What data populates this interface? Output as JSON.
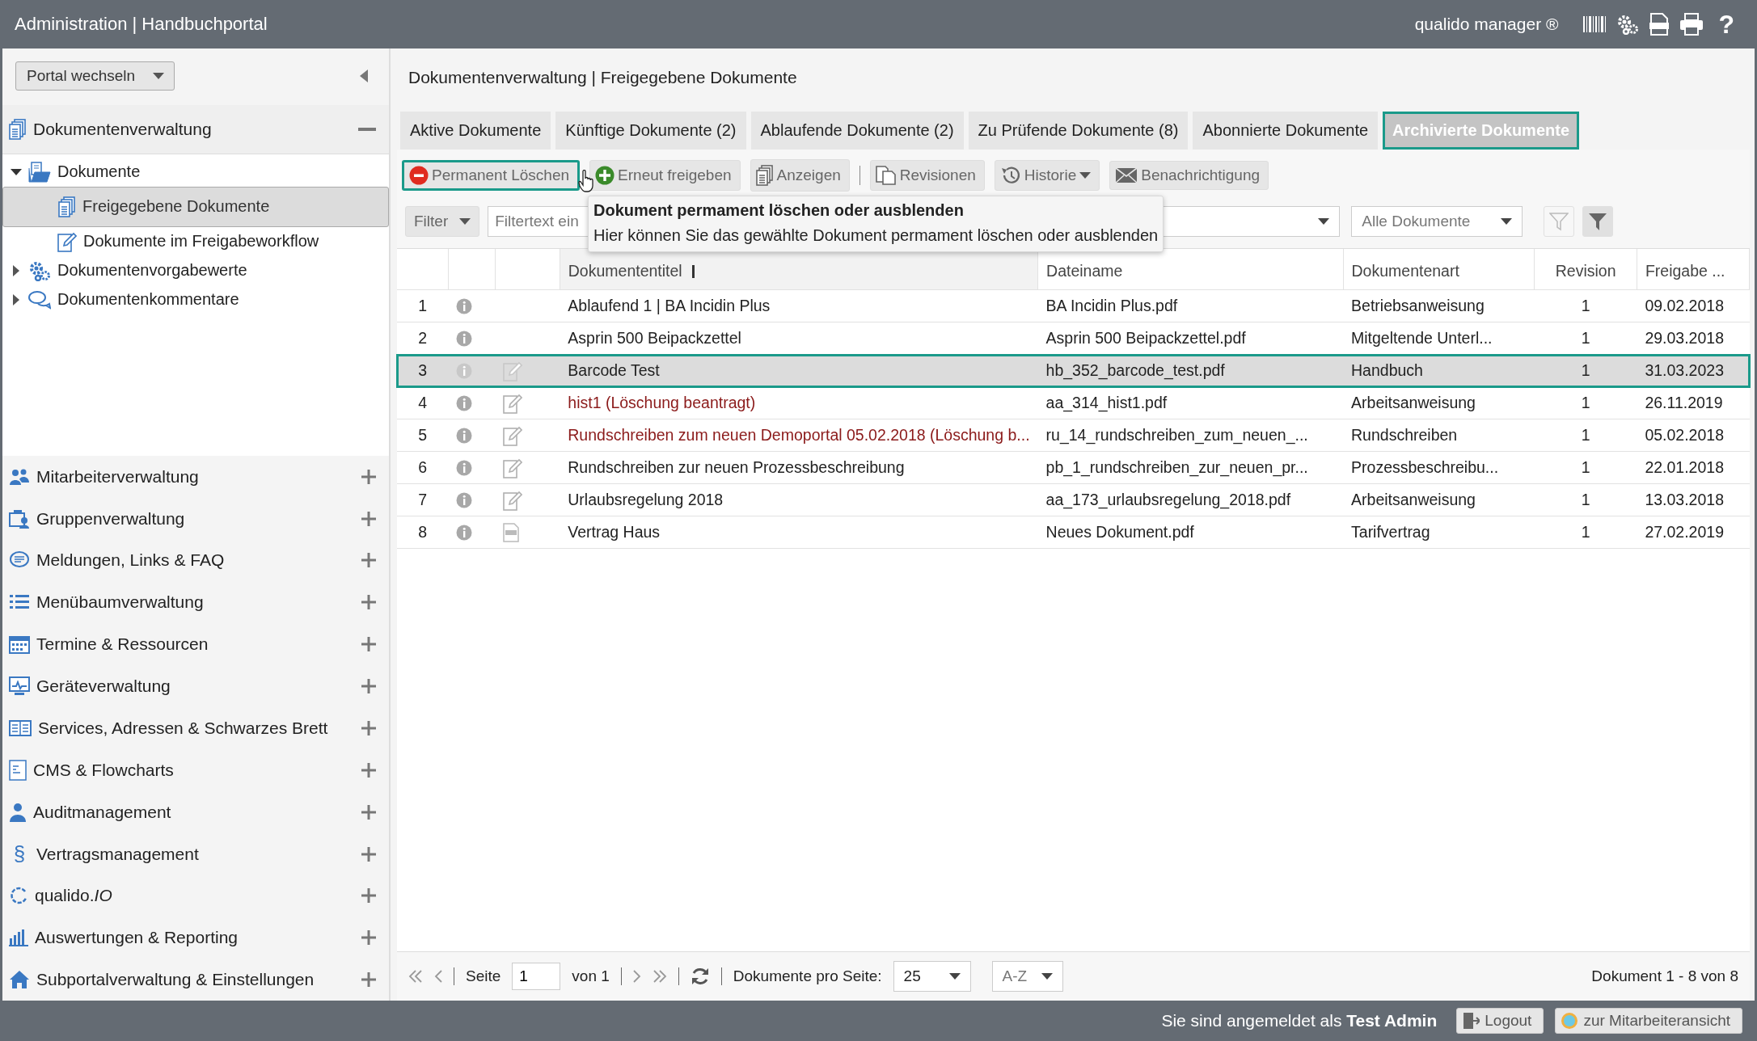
{
  "header": {
    "title": "Administration | Handbuchportal",
    "product": "qualido manager ®",
    "help": "?"
  },
  "sidebar": {
    "portal_switch": "Portal wechseln",
    "sections": [
      {
        "label": "Dokumentenverwaltung",
        "expanded": true,
        "tree": [
          {
            "label": "Dokumente",
            "expanded": true,
            "selected": false,
            "children": [
              {
                "label": "Freigegebene Dokumente",
                "selected": true
              },
              {
                "label": "Dokumente im Freigabeworkflow",
                "selected": false
              }
            ]
          },
          {
            "label": "Dokumentenvorgabewerte",
            "expanded": false,
            "selected": false
          },
          {
            "label": "Dokumentenkommentare",
            "expanded": false,
            "selected": false
          }
        ]
      },
      {
        "label": "Mitarbeiterverwaltung",
        "expanded": false
      },
      {
        "label": "Gruppenverwaltung",
        "expanded": false
      },
      {
        "label": "Meldungen, Links & FAQ",
        "expanded": false
      },
      {
        "label": "Menübaumverwaltung",
        "expanded": false
      },
      {
        "label": "Termine & Ressourcen",
        "expanded": false
      },
      {
        "label": "Geräteverwaltung",
        "expanded": false
      },
      {
        "label": "Services, Adressen & Schwarzes Brett",
        "expanded": false
      },
      {
        "label": "CMS & Flowcharts",
        "expanded": false
      },
      {
        "label": "Auditmanagement",
        "expanded": false
      },
      {
        "label": "Vertragsmanagement",
        "expanded": false,
        "symbol": "§"
      },
      {
        "label": "qualido.*IO*",
        "expanded": false
      },
      {
        "label": "Auswertungen & Reporting",
        "expanded": false
      },
      {
        "label": "Subportalverwaltung & Einstellungen",
        "expanded": false
      }
    ]
  },
  "main": {
    "breadcrumb": "Dokumentenverwaltung | Freigegebene Dokumente",
    "tabs": [
      {
        "label": "Aktive Dokumente",
        "selected": false
      },
      {
        "label": "Künftige Dokumente (2)",
        "selected": false
      },
      {
        "label": "Ablaufende Dokumente (2)",
        "selected": false
      },
      {
        "label": "Zu Prüfende Dokumente (8)",
        "selected": false
      },
      {
        "label": "Abonnierte Dokumente",
        "selected": false
      },
      {
        "label": "Archivierte Dokumente",
        "selected": true
      }
    ],
    "toolbar": [
      {
        "kind": "delete",
        "label": "Permanent Löschen",
        "focused": true
      },
      {
        "kind": "release",
        "label": "Erneut freigeben",
        "focused": false
      },
      {
        "kind": "view",
        "label": "Anzeigen",
        "focused": false
      },
      {
        "kind": "separator"
      },
      {
        "kind": "revisions",
        "label": "Revisionen",
        "focused": false
      },
      {
        "kind": "history",
        "label": "Historie",
        "focused": false
      },
      {
        "kind": "notify",
        "label": "Benachrichtigung",
        "focused": false
      }
    ],
    "filter": {
      "label": "Filter",
      "placeholder": "Filtertext ein",
      "scope": "Alle Dokumente"
    },
    "tooltip": {
      "title": "Dokument permament löschen oder ausblenden",
      "text": "Hier können Sie das gewählte Dokument permament löschen oder ausblenden"
    },
    "table": {
      "columns": [
        "Dokumententitel",
        "Dateiname",
        "Dokumentenart",
        "Revision",
        "Freigabe ..."
      ],
      "rows": [
        {
          "number": "1",
          "kind": "plain",
          "title": "Ablaufend 1 | BA Incidin Plus",
          "file": "BA Incidin Plus.pdf",
          "type": "Betriebsanweisung",
          "revision": "1",
          "date": "09.02.2018",
          "deletion_pending": false,
          "selected": false
        },
        {
          "number": "2",
          "kind": "plain",
          "title": "Asprin 500 Beipackzettel",
          "file": "Asprin 500 Beipackzettel.pdf",
          "type": "Mitgeltende Unterl...",
          "revision": "1",
          "date": "29.03.2018",
          "deletion_pending": false,
          "selected": false
        },
        {
          "number": "3",
          "kind": "editable",
          "title": "Barcode Test",
          "file": "hb_352_barcode_test.pdf",
          "type": "Handbuch",
          "revision": "1",
          "date": "31.03.2023",
          "deletion_pending": false,
          "selected": true
        },
        {
          "number": "4",
          "kind": "editable",
          "title": "hist1 (Löschung beantragt)",
          "file": "aa_314_hist1.pdf",
          "type": "Arbeitsanweisung",
          "revision": "1",
          "date": "26.11.2019",
          "deletion_pending": true,
          "selected": false
        },
        {
          "number": "5",
          "kind": "editable",
          "title": "Rundschreiben zum neuen Demoportal 05.02.2018 (Löschung b...",
          "file": "ru_14_rundschreiben_zum_neuen_...",
          "type": "Rundschreiben",
          "revision": "1",
          "date": "05.02.2018",
          "deletion_pending": true,
          "selected": false
        },
        {
          "number": "6",
          "kind": "editable",
          "title": "Rundschreiben zur neuen Prozessbeschreibung",
          "file": "pb_1_rundschreiben_zur_neuen_pr...",
          "type": "Prozessbeschreibu...",
          "revision": "1",
          "date": "22.01.2018",
          "deletion_pending": false,
          "selected": false
        },
        {
          "number": "7",
          "kind": "editable",
          "title": "Urlaubsregelung 2018",
          "file": "aa_173_urlaubsregelung_2018.pdf",
          "type": "Arbeitsanweisung",
          "revision": "1",
          "date": "13.03.2018",
          "deletion_pending": false,
          "selected": false
        },
        {
          "number": "8",
          "kind": "file",
          "title": "Vertrag Haus",
          "file": "Neues Dokument.pdf",
          "type": "Tarifvertrag",
          "revision": "1",
          "date": "27.02.2019",
          "deletion_pending": false,
          "selected": false
        }
      ]
    },
    "pager": {
      "page_label": "Seite",
      "page": "1",
      "of": "von 1",
      "per_page_label": "Dokumente pro Seite:",
      "per_page": "25",
      "sort": "A-Z",
      "summary": "Dokument 1 - 8 von 8"
    }
  },
  "footer": {
    "login_text": "Sie sind angemeldet als **Test Admin**",
    "logout": "Logout",
    "switch_view": "zur Mitarbeiteransicht"
  }
}
